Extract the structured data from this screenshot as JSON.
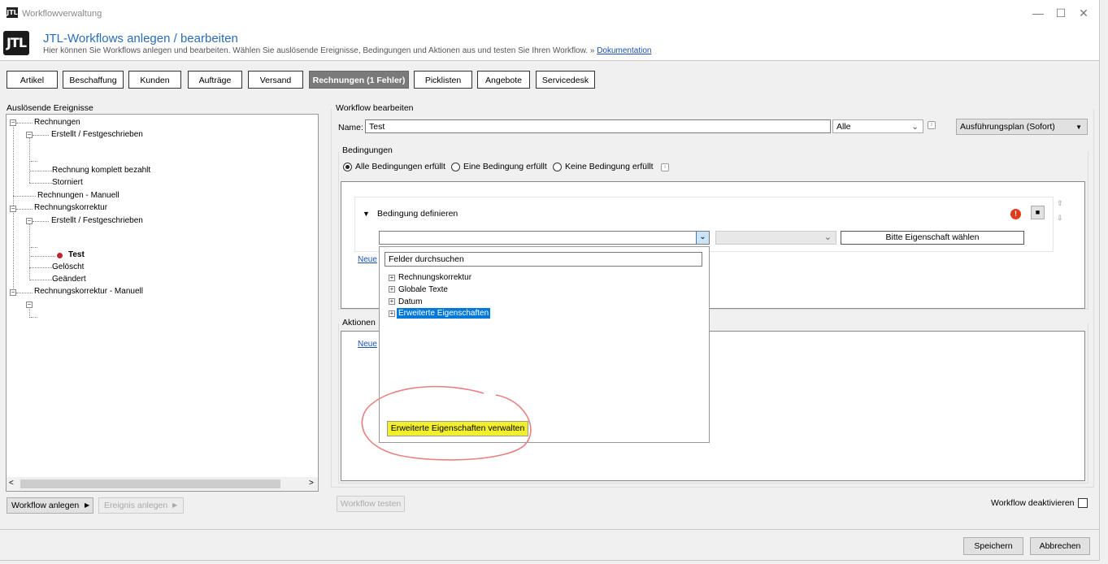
{
  "window": {
    "title": "Workflowverwaltung",
    "icon_text": "JTL",
    "controls": {
      "minimize": "—",
      "maximize": "☐",
      "close": "✕"
    }
  },
  "header": {
    "logo": "JTL",
    "title": "JTL-Workflows anlegen / bearbeiten",
    "subtitle": "Hier können Sie Workflows anlegen und bearbeiten. Wählen Sie auslösende Ereignisse, Bedingungen und Aktionen aus und testen Sie Ihren Workflow.",
    "doc_prefix": "»",
    "doc_link": "Dokumentation"
  },
  "tabs": [
    "Artikel",
    "Beschaffung",
    "Kunden",
    "Aufträge",
    "Versand",
    "Rechnungen (1 Fehler)",
    "Picklisten",
    "Angebote",
    "Servicedesk"
  ],
  "left": {
    "group_label": "Auslösende Ereignisse",
    "tree": [
      "Rechnungen",
      "Erstellt / Festgeschrieben",
      "Rechnung komplett bezahlt",
      "Storniert",
      "Rechnungen - Manuell",
      "Rechnungskorrektur",
      "Erstellt / Festgeschrieben",
      "Test",
      "Gelöscht",
      "Geändert",
      "Rechnungskorrektur - Manuell"
    ],
    "scroll_left": "<",
    "scroll_right": ">",
    "workflow_button": "Workflow anlegen",
    "event_button": "Ereignis anlegen"
  },
  "right": {
    "group_label": "Workflow bearbeiten",
    "name_label": "Name:",
    "name_value": "Test",
    "scope_value": "Alle",
    "plan_value": "Ausführungsplan (Sofort)",
    "conditions_label": "Bedingungen",
    "radios": [
      "Alle Bedingungen erfüllt",
      "Eine Bedingung erfüllt",
      "Keine Bedingung erfüllt"
    ],
    "condition_title": "Bedingung definieren",
    "property_button": "Bitte Eigenschaft wählen",
    "new_condition_link": "Neue",
    "actions_label": "Aktionen",
    "new_action_link": "Neue",
    "test_button": "Workflow testen",
    "deactivate_label": "Workflow deaktivieren"
  },
  "dropdown": {
    "search_placeholder": "Felder durchsuchen",
    "items": [
      "Rechnungskorrektur",
      "Globale Texte",
      "Datum",
      "Erweiterte Eigenschaften"
    ],
    "manage_button": "Erweiterte Eigenschaften verwalten"
  },
  "footer": {
    "save": "Speichern",
    "cancel": "Abbrechen"
  },
  "colors": {
    "title_blue": "#2b6db4",
    "selection": "#0078d7",
    "highlight": "#f0f000",
    "annotation": "#e88080",
    "error": "#e03c1c"
  }
}
